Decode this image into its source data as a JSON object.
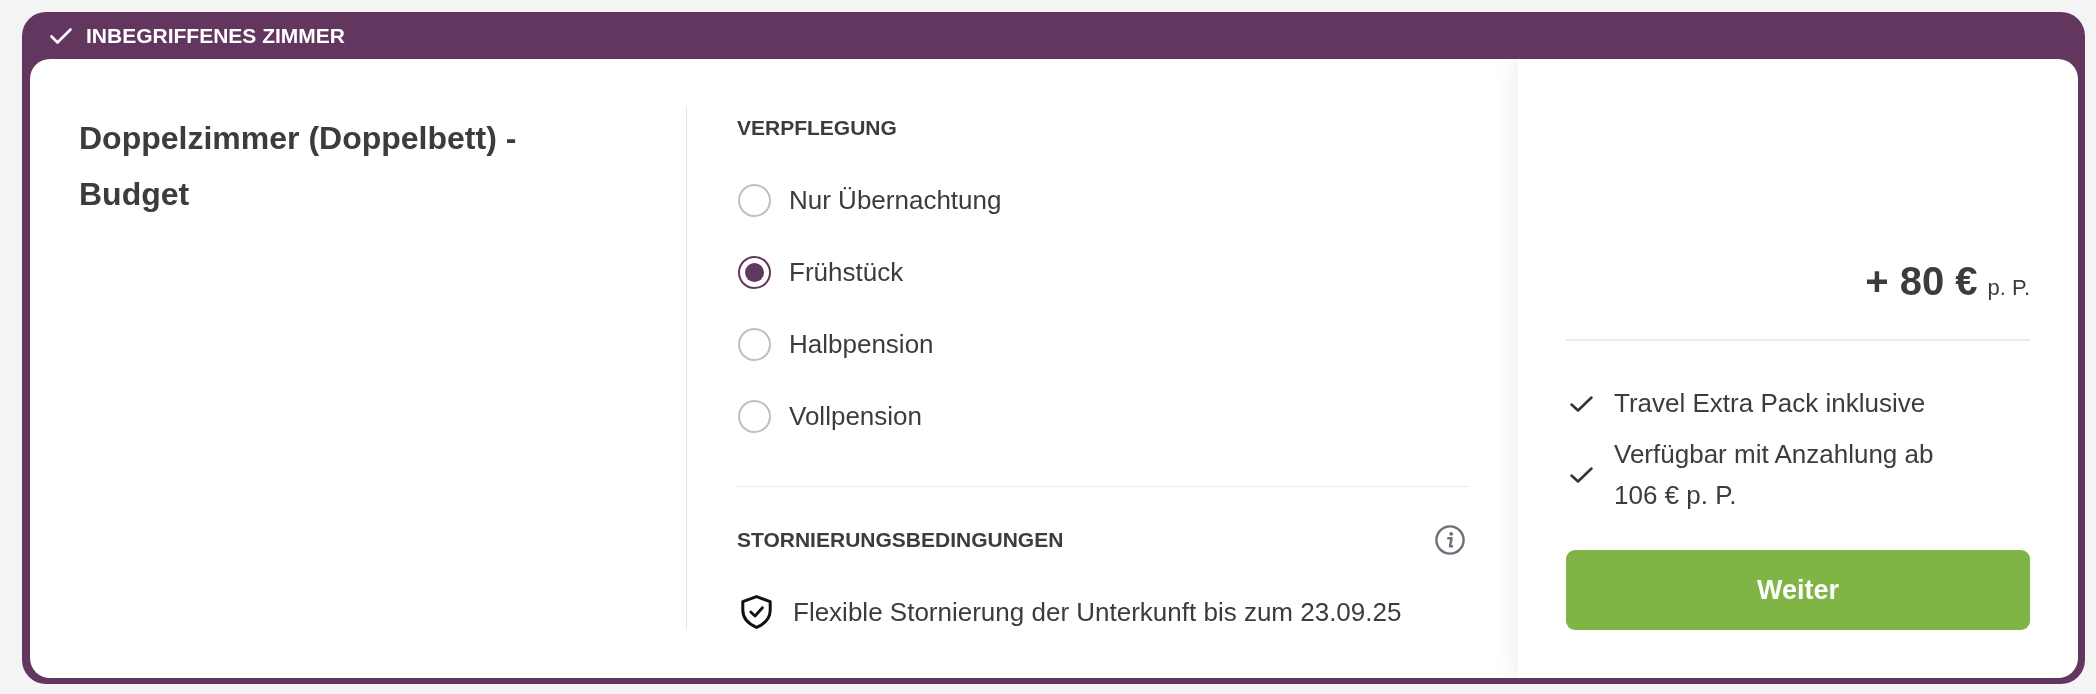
{
  "banner": {
    "label": "INBEGRIFFENES ZIMMER"
  },
  "room": {
    "name": "Doppelzimmer (Doppelbett) - Budget"
  },
  "board": {
    "heading": "VERPFLEGUNG",
    "options": [
      {
        "label": "Nur Übernachtung",
        "selected": false
      },
      {
        "label": "Frühstück",
        "selected": true
      },
      {
        "label": "Halbpension",
        "selected": false
      },
      {
        "label": "Vollpension",
        "selected": false
      }
    ]
  },
  "cancellation": {
    "heading": "STORNIERUNGSBEDINGUNGEN",
    "policy": "Flexible Stornierung der Unterkunft bis zum 23.09.25"
  },
  "price": {
    "amount": "+ 80 €",
    "unit": "p. P."
  },
  "features": [
    "Travel Extra Pack inklusive",
    "Verfügbar mit Anzahlung ab 106 € p. P."
  ],
  "button": {
    "label": "Weiter"
  }
}
